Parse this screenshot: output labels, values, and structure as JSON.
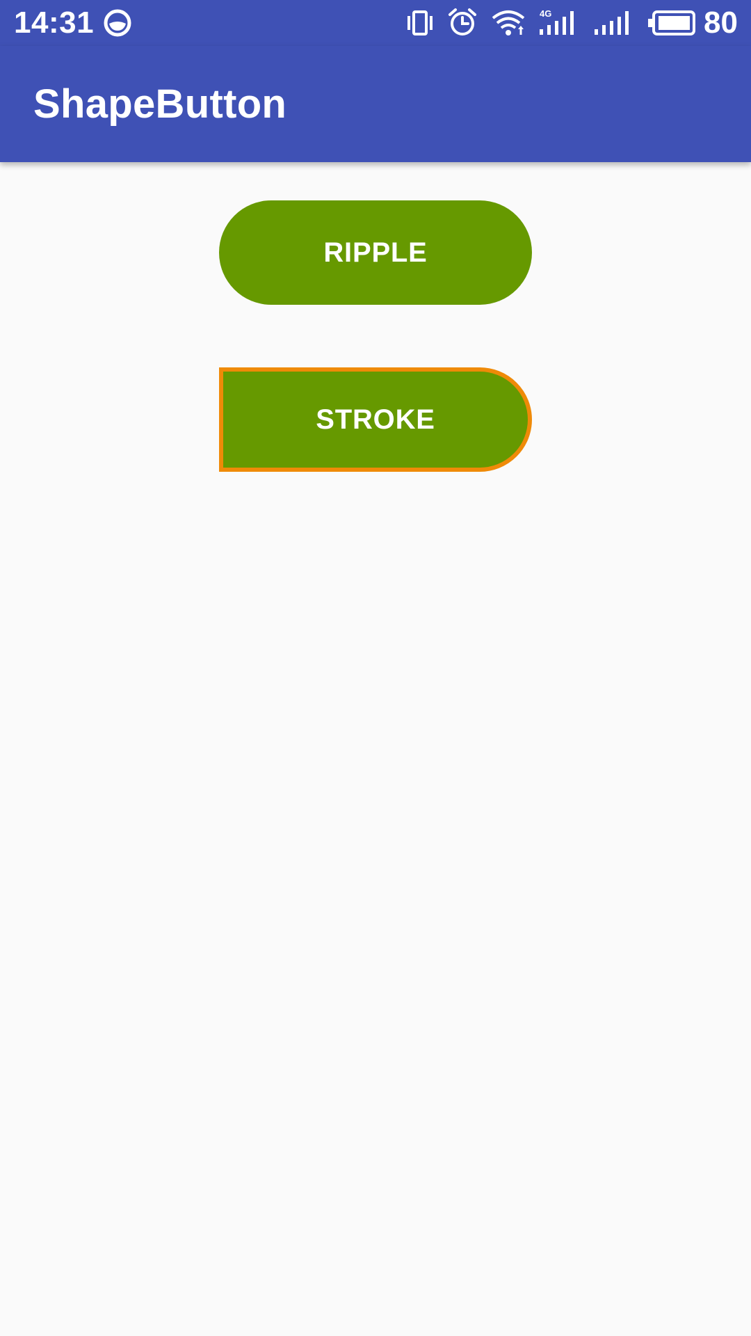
{
  "status_bar": {
    "time": "14:31",
    "battery_level": "80",
    "icons": [
      "app-notification-icon",
      "vibrate-icon",
      "alarm-icon",
      "wifi-icon",
      "signal-4g-icon",
      "signal-icon",
      "battery-icon"
    ],
    "network_type": "4G",
    "background_color": "#3F51B5"
  },
  "app_bar": {
    "title": "ShapeButton",
    "background_color": "#3F51B5"
  },
  "buttons": {
    "ripple": {
      "label": "RIPPLE",
      "fill_color": "#669900"
    },
    "stroke": {
      "label": "STROKE",
      "fill_color": "#669900",
      "stroke_color": "#EF8A08"
    }
  },
  "theme": {
    "background": "#FAFAFA",
    "text_on_primary": "#FFFFFF"
  }
}
